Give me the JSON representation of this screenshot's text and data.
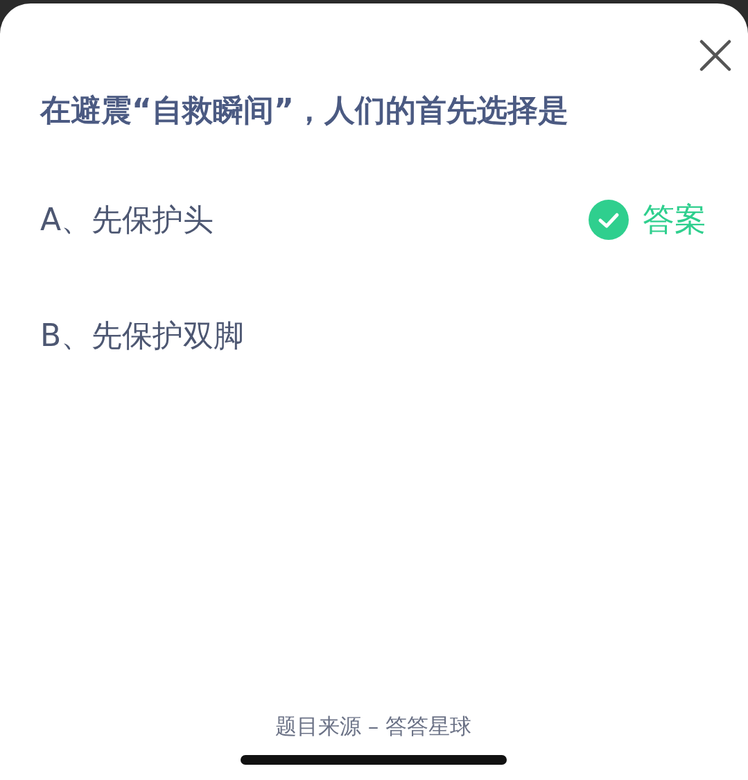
{
  "question": "在避震“自救瞬间”，人们的首先选择是",
  "options": [
    {
      "label": "A、先保护头",
      "correct": true
    },
    {
      "label": "B、先保护双脚",
      "correct": false
    }
  ],
  "answer_label": "答案",
  "footer": "题目来源 – 答答星球"
}
